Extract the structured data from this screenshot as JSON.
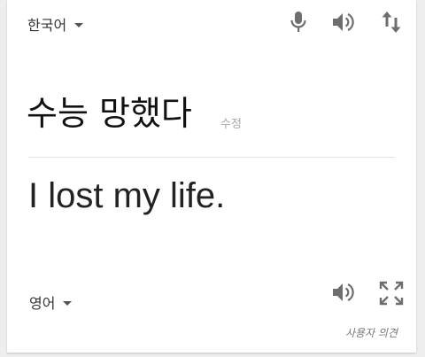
{
  "source": {
    "language": "한국어",
    "text": "수능 망했다",
    "edit_label": "수정"
  },
  "target": {
    "language": "영어",
    "text": "I lost my life."
  },
  "feedback_label": "사용자 의견",
  "icons": {
    "mic": "microphone-icon",
    "speaker": "speaker-icon",
    "swap": "swap-languages-icon",
    "fullscreen": "fullscreen-icon",
    "dropdown": "caret-down-icon"
  },
  "colors": {
    "icon": "#6e6e6e",
    "text_primary": "#111111",
    "text_muted": "#a8a8a8",
    "background": "#eeeeee",
    "card": "#ffffff"
  }
}
